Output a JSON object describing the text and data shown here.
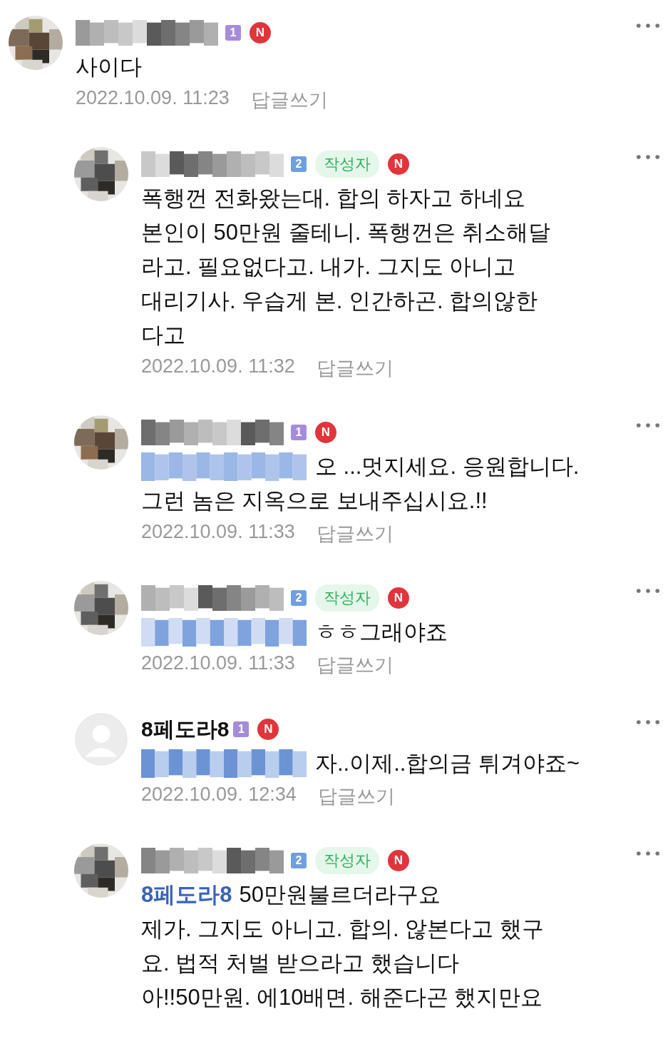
{
  "comments": [
    {
      "kind": "comment",
      "author": {
        "kind": "redacted"
      },
      "grade": {
        "text": "1",
        "color": "#a78bdb"
      },
      "is_writer": false,
      "new_badge": "N",
      "text": "사이다",
      "date": "2022.10.09. 11:23",
      "reply_link": "답글쓰기"
    },
    {
      "kind": "reply",
      "author": {
        "kind": "redacted"
      },
      "grade": {
        "text": "2",
        "color": "#6f9fe0"
      },
      "is_writer": true,
      "writer_badge": "작성자",
      "new_badge": "N",
      "text": "폭행껀 전화왔는대. 합의 하자고 하네요\n본인이 50만원 줄테니. 폭행껀은 취소해달\n라고. 필요없다고. 내가. 그지도 아니고\n대리기사. 우습게 본. 인간하곤. 합의않한\n다고",
      "date": "2022.10.09. 11:32",
      "reply_link": "답글쓰기"
    },
    {
      "kind": "reply",
      "author": {
        "kind": "redacted"
      },
      "grade": {
        "text": "1",
        "color": "#a78bdb"
      },
      "is_writer": false,
      "new_badge": "N",
      "mention": {
        "kind": "redacted"
      },
      "text": "오 ...멋지세요. 응원합니다.\n그런 놈은 지옥으로 보내주십시요.!!",
      "date": "2022.10.09. 11:33",
      "reply_link": "답글쓰기"
    },
    {
      "kind": "reply",
      "author": {
        "kind": "redacted"
      },
      "grade": {
        "text": "2",
        "color": "#6f9fe0"
      },
      "is_writer": true,
      "writer_badge": "작성자",
      "new_badge": "N",
      "mention": {
        "kind": "redacted"
      },
      "text": "ㅎㅎ그래야죠",
      "date": "2022.10.09. 11:33",
      "reply_link": "답글쓰기"
    },
    {
      "kind": "reply",
      "avatar": {
        "kind": "default"
      },
      "author": {
        "kind": "name",
        "name": "8페도라8"
      },
      "grade": {
        "text": "1",
        "color": "#a78bdb"
      },
      "is_writer": false,
      "new_badge": "N",
      "mention": {
        "kind": "redacted"
      },
      "text": "자..이제..합의금 튀겨야죠~",
      "date": "2022.10.09. 12:34",
      "reply_link": "답글쓰기"
    },
    {
      "kind": "reply",
      "author": {
        "kind": "redacted"
      },
      "grade": {
        "text": "2",
        "color": "#6f9fe0"
      },
      "is_writer": true,
      "writer_badge": "작성자",
      "new_badge": "N",
      "mention": {
        "kind": "name",
        "name": "8페도라8"
      },
      "text": "50만원불르더라구요\n제가. 그지도 아니고. 합의. 않본다고 했구\n요. 법적 처벌 받으라고 했습니다\n아!!50만원. 에10배면. 해준다곤 했지만요"
    }
  ]
}
